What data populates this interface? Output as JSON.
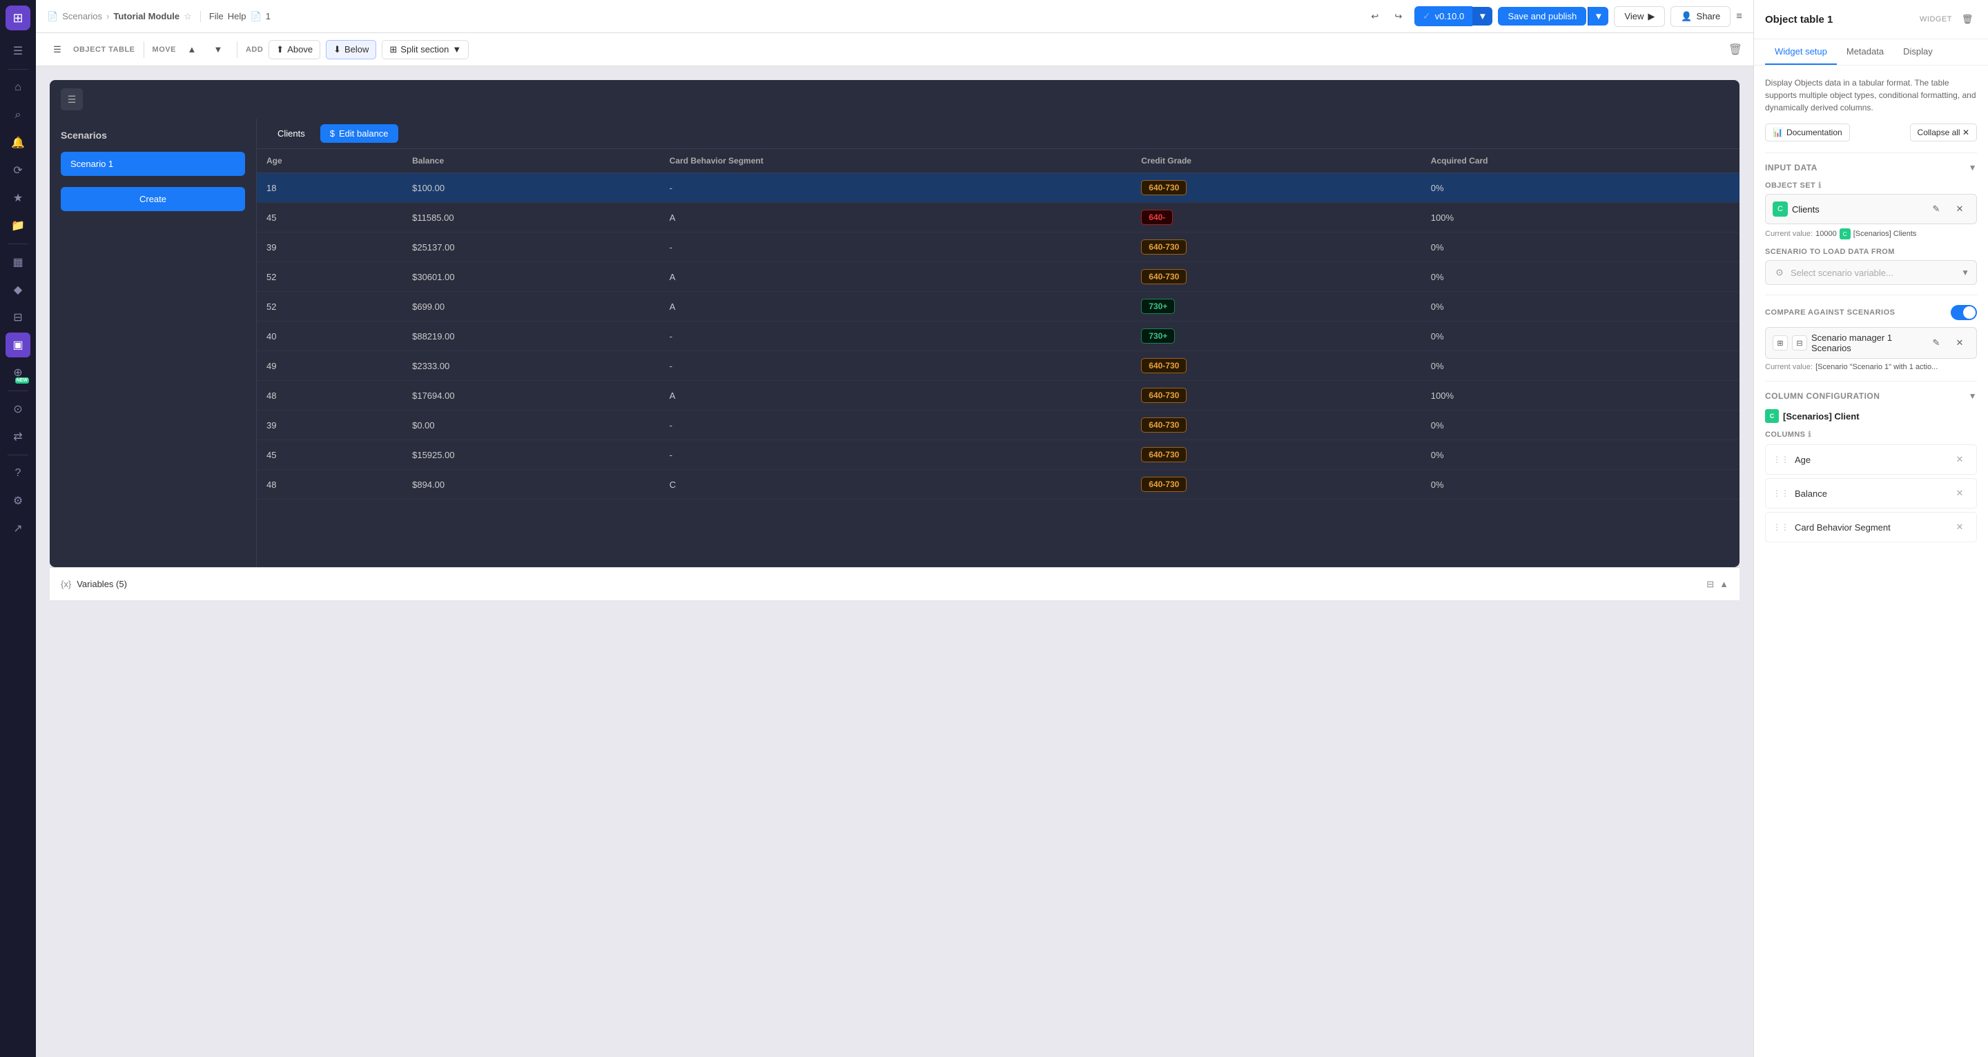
{
  "app": {
    "logo": "⊞",
    "breadcrumb": {
      "parent": "Scenarios",
      "separator": "›",
      "current": "Tutorial Module",
      "star": "☆"
    },
    "file_menu": "File",
    "help_menu": "Help",
    "pages": "1",
    "version_btn": "v0.10.0",
    "save_publish": "Save and publish",
    "view_btn": "View",
    "share_btn": "Share"
  },
  "toolbar": {
    "object_table_label": "OBJECT TABLE",
    "move_label": "MOVE",
    "add_label": "ADD",
    "above_btn": "Above",
    "below_btn": "Below",
    "split_section_btn": "Split section"
  },
  "widget": {
    "scenarios_title": "Scenarios",
    "scenarios": [
      {
        "name": "Scenario 1",
        "active": true
      }
    ],
    "create_btn": "Create",
    "tabs": [
      {
        "name": "Clients",
        "active": true
      }
    ],
    "edit_balance_btn": "Edit balance",
    "table_columns": [
      "Age",
      "Balance",
      "Card Behavior Segment",
      "Credit Grade",
      "Acquired Card"
    ],
    "table_rows": [
      {
        "age": "18",
        "balance": "$100.00",
        "cbs": "-",
        "credit_grade": "640-730",
        "credit_grade_type": "orange",
        "acquired_card": "0%",
        "selected": true
      },
      {
        "age": "45",
        "balance": "$11585.00",
        "cbs": "A",
        "credit_grade": "640-",
        "credit_grade_type": "red",
        "acquired_card": "100%"
      },
      {
        "age": "39",
        "balance": "$25137.00",
        "cbs": "-",
        "credit_grade": "640-730",
        "credit_grade_type": "orange",
        "acquired_card": "0%"
      },
      {
        "age": "52",
        "balance": "$30601.00",
        "cbs": "A",
        "credit_grade": "640-730",
        "credit_grade_type": "orange",
        "acquired_card": "0%"
      },
      {
        "age": "52",
        "balance": "$699.00",
        "cbs": "A",
        "credit_grade": "730+",
        "credit_grade_type": "green",
        "acquired_card": "0%"
      },
      {
        "age": "40",
        "balance": "$88219.00",
        "cbs": "-",
        "credit_grade": "730+",
        "credit_grade_type": "green",
        "acquired_card": "0%"
      },
      {
        "age": "49",
        "balance": "$2333.00",
        "cbs": "-",
        "credit_grade": "640-730",
        "credit_grade_type": "orange",
        "acquired_card": "0%"
      },
      {
        "age": "48",
        "balance": "$17694.00",
        "cbs": "A",
        "credit_grade": "640-730",
        "credit_grade_type": "orange",
        "acquired_card": "100%"
      },
      {
        "age": "39",
        "balance": "$0.00",
        "cbs": "-",
        "credit_grade": "640-730",
        "credit_grade_type": "orange",
        "acquired_card": "0%"
      },
      {
        "age": "45",
        "balance": "$15925.00",
        "cbs": "-",
        "credit_grade": "640-730",
        "credit_grade_type": "orange",
        "acquired_card": "0%"
      },
      {
        "age": "48",
        "balance": "$894.00",
        "cbs": "C",
        "credit_grade": "640-730",
        "credit_grade_type": "orange",
        "acquired_card": "0%"
      }
    ]
  },
  "right_panel": {
    "title": "Object table 1",
    "widget_label": "WIDGET",
    "tabs": [
      "Widget setup",
      "Metadata",
      "Display"
    ],
    "active_tab": "Widget setup",
    "description": "Display Objects data in a tabular format. The table supports multiple object types, conditional formatting, and dynamically derived columns.",
    "doc_btn": "Documentation",
    "collapse_all_btn": "Collapse all",
    "input_data_section": "INPUT DATA",
    "object_set_label": "OBJECT SET",
    "object_set_name": "Clients",
    "current_value_label": "Current value:",
    "current_value": "10000",
    "current_value_icon": "C",
    "current_value_text": "[Scenarios] Clients",
    "scenario_load_label": "SCENARIO TO LOAD DATA FROM",
    "scenario_placeholder": "Select scenario variable...",
    "compare_label": "COMPARE AGAINST SCENARIOS",
    "scenario_mgr_icon1": "⊞",
    "scenario_mgr_icon2": "⊟",
    "scenario_mgr_name": "Scenario manager 1 Scenarios",
    "current_value2": "Current value:",
    "current_value2_text": "[Scenario \"Scenario 1\" with 1 actio...",
    "col_config_section": "COLUMN CONFIGURATION",
    "col_config_entity": "[Scenarios] Client",
    "columns_label": "COLUMNS",
    "columns_hint": "ℹ",
    "columns": [
      "Age",
      "Balance",
      "Card Behavior Segment"
    ],
    "variables_label": "Variables (5)"
  },
  "sidebar": {
    "icons": [
      {
        "name": "menu-icon",
        "glyph": "☰",
        "active": false
      },
      {
        "name": "home-icon",
        "glyph": "⌂",
        "active": false
      },
      {
        "name": "search-icon",
        "glyph": "⌕",
        "active": false
      },
      {
        "name": "bell-icon",
        "glyph": "🔔",
        "active": false
      },
      {
        "name": "history-icon",
        "glyph": "⟳",
        "active": false
      },
      {
        "name": "star-icon",
        "glyph": "★",
        "active": false
      },
      {
        "name": "folder-icon",
        "glyph": "📁",
        "active": false
      },
      {
        "name": "code-icon",
        "glyph": "⊞",
        "active": false
      },
      {
        "name": "cube-icon",
        "glyph": "◆",
        "active": false
      },
      {
        "name": "grid-icon",
        "glyph": "⊟",
        "active": false
      },
      {
        "name": "monitor-icon",
        "glyph": "▣",
        "active": true
      },
      {
        "name": "new-icon",
        "glyph": "⊕",
        "active": false,
        "new": true
      },
      {
        "name": "globe-icon",
        "glyph": "⊙",
        "active": false
      },
      {
        "name": "shuffle-icon",
        "glyph": "⇄",
        "active": false
      },
      {
        "name": "help-icon",
        "glyph": "?",
        "active": false
      },
      {
        "name": "settings-icon",
        "glyph": "⚙",
        "active": false
      },
      {
        "name": "arrow-up-right-icon",
        "glyph": "↗",
        "active": false
      }
    ]
  }
}
